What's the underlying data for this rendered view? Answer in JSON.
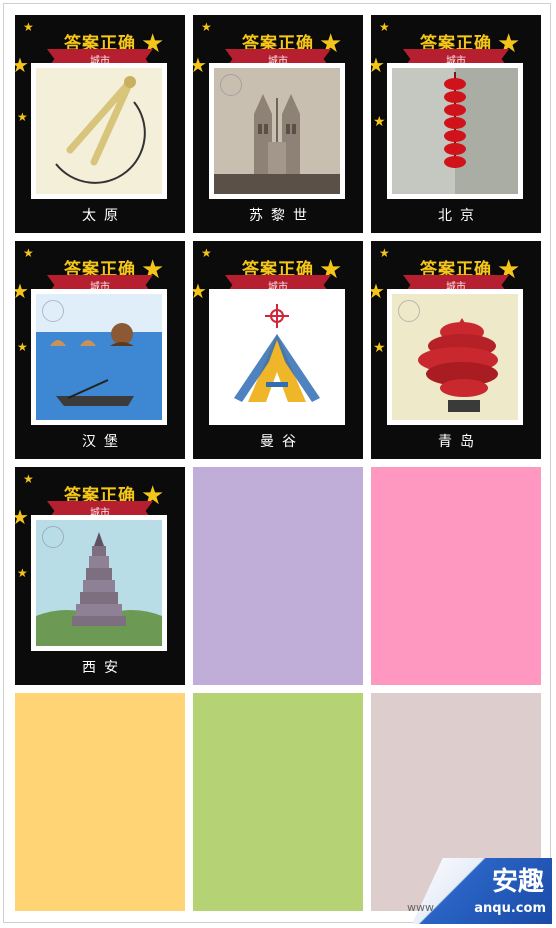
{
  "cards": [
    {
      "banner": "答案正确",
      "category": "城市",
      "city": "太原",
      "picture": "compass-drawing"
    },
    {
      "banner": "答案正确",
      "category": "城市",
      "city": "苏黎世",
      "picture": "cathedral-towers"
    },
    {
      "banner": "答案正确",
      "category": "城市",
      "city": "北京",
      "picture": "red-lantern-string"
    },
    {
      "banner": "答案正确",
      "category": "城市",
      "city": "汉堡",
      "picture": "swimmers-and-boat"
    },
    {
      "banner": "答案正确",
      "category": "城市",
      "city": "曼谷",
      "picture": "temple-a-shape"
    },
    {
      "banner": "答案正确",
      "category": "城市",
      "city": "青岛",
      "picture": "may-wind-sculpture"
    },
    {
      "banner": "答案正确",
      "category": "城市",
      "city": "西安",
      "picture": "big-wild-goose-pagoda"
    }
  ],
  "blank_tiles": [
    {
      "color": "#c1aed8"
    },
    {
      "color": "#ff98c0"
    },
    {
      "color": "#ffd475"
    },
    {
      "color": "#b5d275"
    },
    {
      "color": "#ddcdcc"
    }
  ],
  "watermark": {
    "main": "安趣",
    "site": "anqu.com",
    "prefix": "www"
  }
}
